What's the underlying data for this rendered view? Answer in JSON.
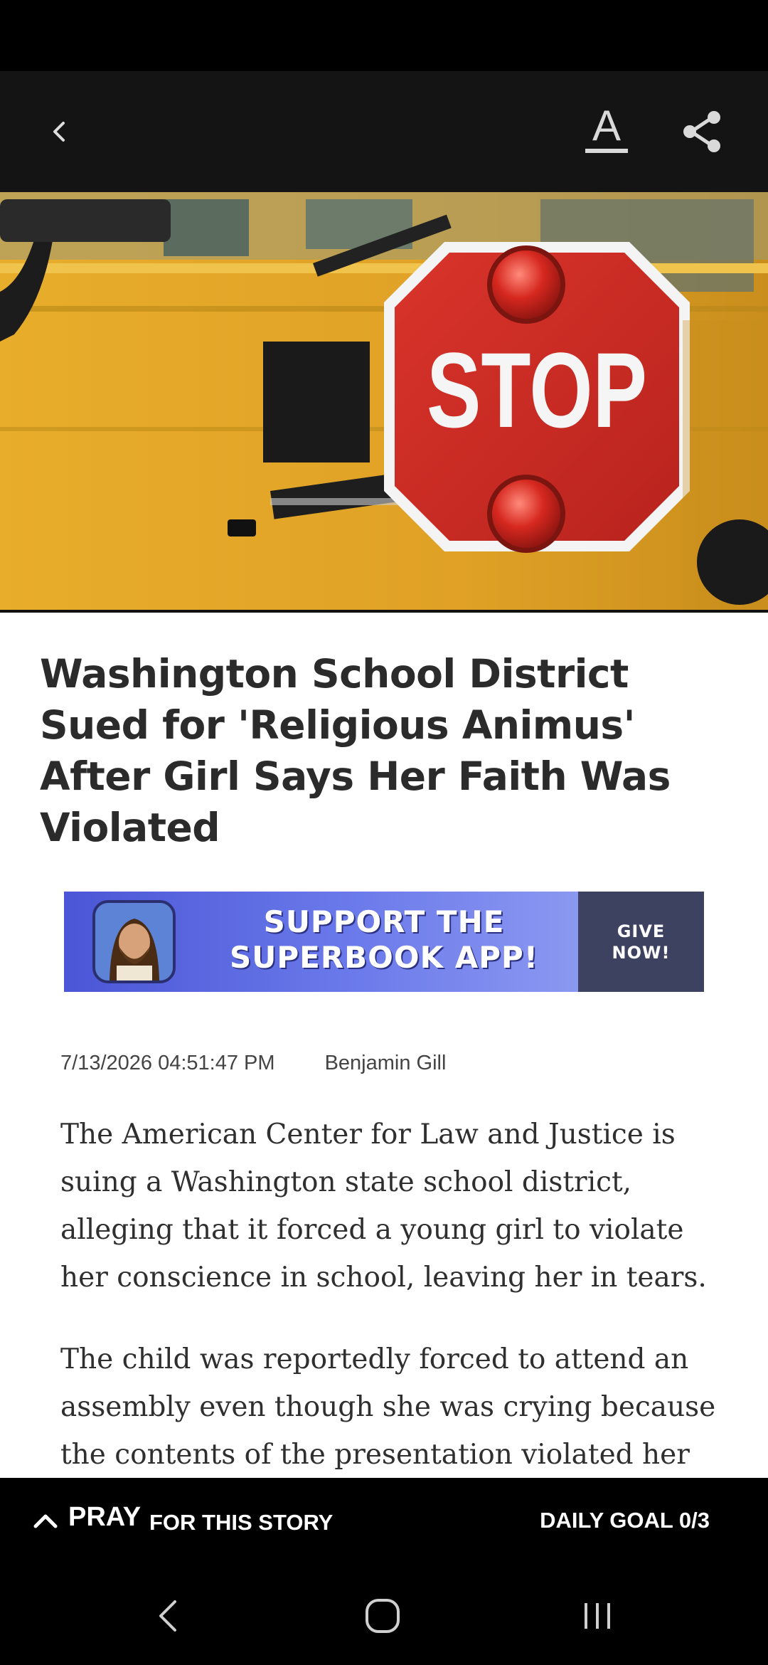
{
  "app_bar": {
    "back_icon": "chevron-left-icon",
    "font_icon": "text-size-icon",
    "font_glyph": "A",
    "share_icon": "share-icon"
  },
  "hero": {
    "sign_text": "STOP"
  },
  "article": {
    "headline": "Washington School District Sued for 'Religious Animus' After Girl Says Her Faith Was Violated",
    "date": "7/13/2026 04:51:47 PM",
    "author": "Benjamin Gill",
    "paragraphs": [
      "The American Center for Law and Justice is suing a Washington state school district, alleging that it forced a young girl to violate her conscience in school, leaving her in tears.",
      "The child was reportedly forced to attend an assembly even though she was crying because the contents of the presentation violated her"
    ]
  },
  "banner": {
    "line1": "SUPPORT THE",
    "line2": "SUPERBOOK APP!",
    "give_line1": "GIVE",
    "give_line2": "NOW!"
  },
  "pray_bar": {
    "chevron_icon": "chevron-up-icon",
    "pray_label": "PRAY",
    "pray_sub": "FOR THIS STORY",
    "goal": "DAILY GOAL 0/3"
  },
  "nav": {
    "back_icon": "nav-back-icon",
    "home_icon": "nav-home-icon",
    "recent_icon": "nav-recents-icon"
  }
}
